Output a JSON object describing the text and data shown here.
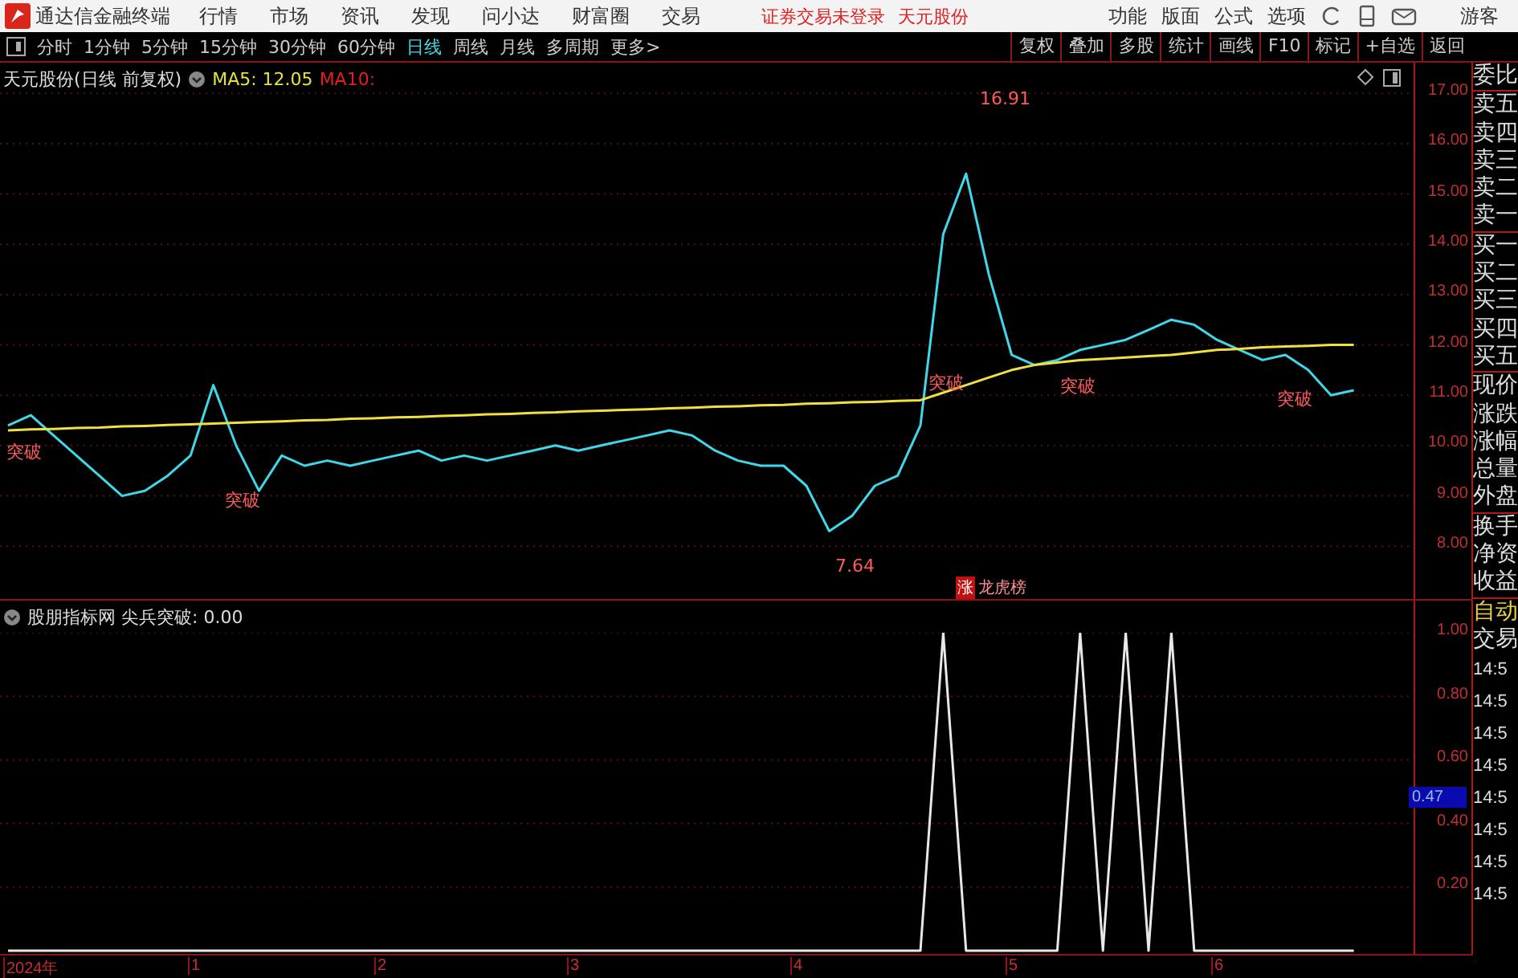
{
  "app": {
    "title": "通达信金融终端",
    "menus": [
      "行情",
      "市场",
      "资讯",
      "发现",
      "问小达",
      "财富圈",
      "交易"
    ],
    "login_status": "证券交易未登录",
    "stock_name": "天元股份",
    "tools": [
      "功能",
      "版面",
      "公式",
      "选项"
    ],
    "user": "游客"
  },
  "toolbar": {
    "periods": [
      {
        "label": "分时",
        "selected": false
      },
      {
        "label": "1分钟",
        "selected": false
      },
      {
        "label": "5分钟",
        "selected": false
      },
      {
        "label": "15分钟",
        "selected": false
      },
      {
        "label": "30分钟",
        "selected": false
      },
      {
        "label": "60分钟",
        "selected": false
      },
      {
        "label": "日线",
        "selected": true
      },
      {
        "label": "周线",
        "selected": false
      },
      {
        "label": "月线",
        "selected": false
      },
      {
        "label": "多周期",
        "selected": false
      },
      {
        "label": "更多>",
        "selected": false
      }
    ],
    "actions": [
      "复权",
      "叠加",
      "多股",
      "统计",
      "画线",
      "F10",
      "标记",
      "+自选",
      "返回"
    ]
  },
  "price_panel": {
    "title": "天元股份(日线 前复权)",
    "ma5": "MA5: 12.05",
    "ma10": "MA10:",
    "events": [
      "涨",
      "龙虎榜"
    ],
    "chart_data": {
      "type": "line",
      "grid": true,
      "ylim": [
        6.95,
        17.61
      ],
      "yticks": [
        {
          "value": 8,
          "label": "8.00"
        },
        {
          "value": 9,
          "label": "9.00"
        },
        {
          "value": 10,
          "label": "10.00"
        },
        {
          "value": 11,
          "label": "11.00"
        },
        {
          "value": 12,
          "label": "12.00"
        },
        {
          "value": 13,
          "label": "13.00"
        },
        {
          "value": 14,
          "label": "14.00"
        },
        {
          "value": 15,
          "label": "15.00"
        },
        {
          "value": 16,
          "label": "16.00"
        },
        {
          "value": 17,
          "label": "17.00"
        }
      ],
      "series": [
        {
          "color": "#3fd8e8",
          "values": [
            10.4,
            10.6,
            10.2,
            9.8,
            9.4,
            9.0,
            9.1,
            9.4,
            9.8,
            11.2,
            10.0,
            9.1,
            9.8,
            9.6,
            9.7,
            9.6,
            9.7,
            9.8,
            9.9,
            9.7,
            9.8,
            9.7,
            9.8,
            9.9,
            10.0,
            9.9,
            10.0,
            10.1,
            10.2,
            10.3,
            10.2,
            9.9,
            9.7,
            9.6,
            9.6,
            9.2,
            8.3,
            8.6,
            9.2,
            9.4,
            10.4,
            14.2,
            15.4,
            13.4,
            11.8,
            11.6,
            11.7,
            11.9,
            12.0,
            12.1,
            12.3,
            12.5,
            12.4,
            12.1,
            11.9,
            11.7,
            11.8,
            11.5,
            11.0,
            11.1
          ]
        },
        {
          "color": "#f0e040",
          "values": [
            10.3,
            10.32,
            10.33,
            10.35,
            10.36,
            10.38,
            10.39,
            10.41,
            10.42,
            10.44,
            10.45,
            10.47,
            10.48,
            10.5,
            10.51,
            10.53,
            10.54,
            10.56,
            10.57,
            10.59,
            10.6,
            10.62,
            10.63,
            10.65,
            10.66,
            10.68,
            10.69,
            10.71,
            10.72,
            10.74,
            10.75,
            10.77,
            10.78,
            10.8,
            10.81,
            10.83,
            10.84,
            10.86,
            10.87,
            10.89,
            10.9,
            11.05,
            11.2,
            11.35,
            11.5,
            11.6,
            11.65,
            11.7,
            11.72,
            11.75,
            11.78,
            11.8,
            11.85,
            11.9,
            11.92,
            11.95,
            11.97,
            11.98,
            12.0,
            12.0
          ]
        }
      ],
      "annotations": [
        "16.91",
        "7.64",
        "突破",
        "突破",
        "突破",
        "突破",
        "突破"
      ]
    }
  },
  "indicator_panel": {
    "title": "股朋指标网 尖兵突破: 0.00",
    "cursor_value": "0.47",
    "x_axis_labels": [
      "2024年",
      "1",
      "2",
      "3",
      "4",
      "5",
      "6"
    ],
    "chart_data": {
      "type": "line",
      "grid": true,
      "ylim": [
        -0.01,
        1
      ],
      "yticks": [
        {
          "value": 0.2,
          "label": "0.20"
        },
        {
          "value": 0.4,
          "label": "0.40"
        },
        {
          "value": 0.6,
          "label": "0.60"
        },
        {
          "value": 0.8,
          "label": "0.80"
        },
        {
          "value": 1,
          "label": "1.00"
        }
      ],
      "series": [
        {
          "color": "#e8e8e8",
          "values": [
            0,
            0,
            0,
            0,
            0,
            0,
            0,
            0,
            0,
            0,
            0,
            0,
            0,
            0,
            0,
            0,
            0,
            0,
            0,
            0,
            0,
            0,
            0,
            0,
            0,
            0,
            0,
            0,
            0,
            0,
            0,
            0,
            0,
            0,
            0,
            0,
            0,
            0,
            0,
            0,
            0,
            1,
            0,
            0,
            0,
            0,
            0,
            1,
            0,
            1,
            0,
            1,
            0,
            0,
            0,
            0,
            0,
            0,
            0,
            0
          ]
        }
      ]
    }
  },
  "quote_panel": {
    "sections": [
      [
        "委比"
      ],
      [
        "卖五",
        "卖四",
        "卖三",
        "卖二",
        "卖一"
      ],
      [
        "买一",
        "买二",
        "买三",
        "买四",
        "买五"
      ],
      [
        "现价",
        "涨跌",
        "涨幅",
        "总量",
        "外盘"
      ],
      [
        "换手",
        "净资",
        "收益"
      ]
    ]
  },
  "trade_panel": {
    "mode": "自动",
    "title": "交易",
    "times": [
      "14:5",
      "14:5",
      "14:5",
      "14:5",
      "14:5",
      "14:5",
      "14:5",
      "14:5"
    ]
  }
}
